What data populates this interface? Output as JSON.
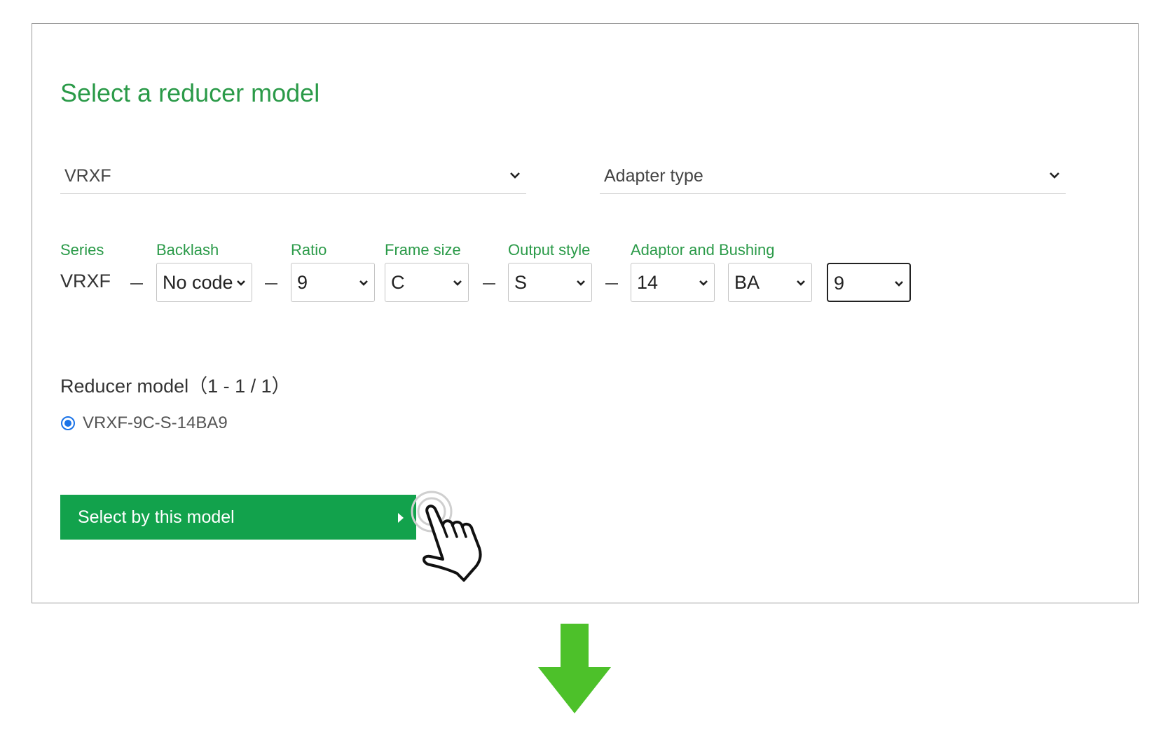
{
  "panel": {
    "title": "Select a reducer model",
    "series_dropdown": {
      "value": "VRXF"
    },
    "adapter_dropdown": {
      "value": "Adapter type"
    },
    "columns": {
      "series_label": "Series",
      "backlash_label": "Backlash",
      "ratio_label": "Ratio",
      "frame_label": "Frame size",
      "output_label": "Output style",
      "adaptor_label": "Adaptor and Bushing"
    },
    "series_value": "VRXF",
    "selects": {
      "backlash": "No code",
      "ratio": "9",
      "frame": "C",
      "output": "S",
      "adaptor": "14",
      "bushing": "BA",
      "bushing_size": "9"
    },
    "result": {
      "title": "Reducer model（1 - 1 / 1）",
      "selected_model": "VRXF-9C-S-14BA9"
    },
    "button_label": "Select by this model"
  },
  "colors": {
    "accent_green": "#2a9a48",
    "button_green": "#12a24c",
    "arrow_green": "#4dc12a",
    "radio_blue": "#1a73e8"
  },
  "icons": [
    "chevron-down-icon",
    "pointer-hand-icon",
    "down-arrow-icon",
    "play-arrow-icon"
  ]
}
